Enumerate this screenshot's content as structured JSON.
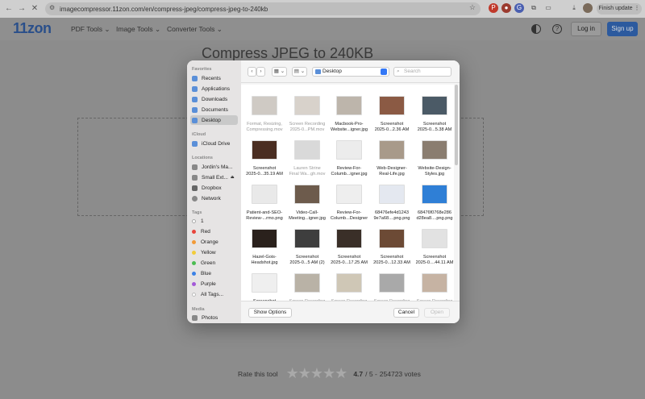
{
  "browser": {
    "url": "imagecompressor.11zon.com/en/compress-jpeg/compress-jpeg-to-240kb",
    "finish_update": "Finish update"
  },
  "site": {
    "logo": "11zon",
    "menu": [
      "PDF Tools",
      "Image Tools",
      "Converter Tools"
    ],
    "login": "Log in",
    "signup": "Sign up"
  },
  "headline": "Compress JPEG to 240KB",
  "rating": {
    "label": "Rate this tool",
    "score": "4.7",
    "out_of": "/ 5 -",
    "votes": "254723 votes",
    "level": 0.94
  },
  "dialog": {
    "sidebar": {
      "favorites_header": "Favorites",
      "favorites": [
        "Recents",
        "Applications",
        "Downloads",
        "Documents",
        "Desktop"
      ],
      "icloud_header": "iCloud",
      "icloud": [
        "iCloud Drive"
      ],
      "locations_header": "Locations",
      "locations": [
        "Jordin's Ma...",
        "Small Ext...",
        "Dropbox",
        "Network"
      ],
      "tags_header": "Tags",
      "tags": [
        {
          "name": "1",
          "color": "#ffffff"
        },
        {
          "name": "Red",
          "color": "#e8453c"
        },
        {
          "name": "Orange",
          "color": "#f29a38"
        },
        {
          "name": "Yellow",
          "color": "#f2cc3a"
        },
        {
          "name": "Green",
          "color": "#4bbd52"
        },
        {
          "name": "Blue",
          "color": "#3c82e6"
        },
        {
          "name": "Purple",
          "color": "#a45ad8"
        },
        {
          "name": "All Tags...",
          "color": "#bbbbbb"
        }
      ],
      "media_header": "Media",
      "media": [
        "Photos"
      ]
    },
    "location": "Desktop",
    "search_placeholder": "Search",
    "files": [
      {
        "name": "Format, Resizing,\nCompressing.mov",
        "dim": true,
        "color": "#cfcac4"
      },
      {
        "name": "Screen Recording\n2025-0...PM.mov",
        "dim": true,
        "color": "#d8d2cb"
      },
      {
        "name": "Macbook-Pro-\nWebsite...igner.jpg",
        "dim": false,
        "color": "#bdb5ab"
      },
      {
        "name": "Screenshot\n2025-0...2.36 AM",
        "dim": false,
        "color": "#8b5a44"
      },
      {
        "name": "Screenshot\n2025-0...5.38 AM",
        "dim": false,
        "color": "#4b5a66"
      },
      {
        "name": "Screenshot\n2025-0...35.19 AM",
        "dim": false,
        "color": "#4a2e22"
      },
      {
        "name": "Lauren Strine\nFinal Wa...gh.mov",
        "dim": true,
        "color": "#d9d9d9"
      },
      {
        "name": "Review-For-\nColumb...igner.jpg",
        "dim": false,
        "color": "#ececec"
      },
      {
        "name": "Web-Designer-\nReal-Life.jpg",
        "dim": false,
        "color": "#a89a8a"
      },
      {
        "name": "Website-Design-\nStyles.jpg",
        "dim": false,
        "color": "#8a7d70"
      },
      {
        "name": "Patient-and-SEO-\nReview-...rmo.png",
        "dim": false,
        "color": "#e9e9e9"
      },
      {
        "name": "Video-Call-\nMeeting...igner.jpg",
        "dim": false,
        "color": "#6d5b4c"
      },
      {
        "name": "Review-For-\nColumb...Designer",
        "dim": false,
        "color": "#eeeeee"
      },
      {
        "name": "68476efe4d1243\n9e7a68....png.png",
        "dim": false,
        "color": "#e4e8f0"
      },
      {
        "name": "68476f0768e286\nd28ea8....png.png",
        "dim": false,
        "color": "#2f7fd6"
      },
      {
        "name": "Hazel-Gois-\nHeadshot.jpg",
        "dim": false,
        "color": "#2a211c"
      },
      {
        "name": "Screenshot\n2025-0...5 AM (2)",
        "dim": false,
        "color": "#3e3e3e"
      },
      {
        "name": "Screenshot\n2025-0...17.25 AM",
        "dim": false,
        "color": "#3a2f28"
      },
      {
        "name": "Screenshot\n2025-0...12.33 AM",
        "dim": false,
        "color": "#6c4a35"
      },
      {
        "name": "Screenshot\n2025-0....44.11 AM",
        "dim": false,
        "color": "#e2e2e2"
      },
      {
        "name": "Screenshot",
        "dim": false,
        "color": "#efefef"
      },
      {
        "name": "Screen Recording",
        "dim": true,
        "color": "#b9b2a6"
      },
      {
        "name": "Screen Recording",
        "dim": true,
        "color": "#cfc7b6"
      },
      {
        "name": "Screen Recording",
        "dim": true,
        "color": "#a9a9a9"
      },
      {
        "name": "Screen Recording",
        "dim": true,
        "color": "#c6b3a3"
      }
    ],
    "show_options": "Show Options",
    "cancel": "Cancel",
    "open": "Open"
  }
}
